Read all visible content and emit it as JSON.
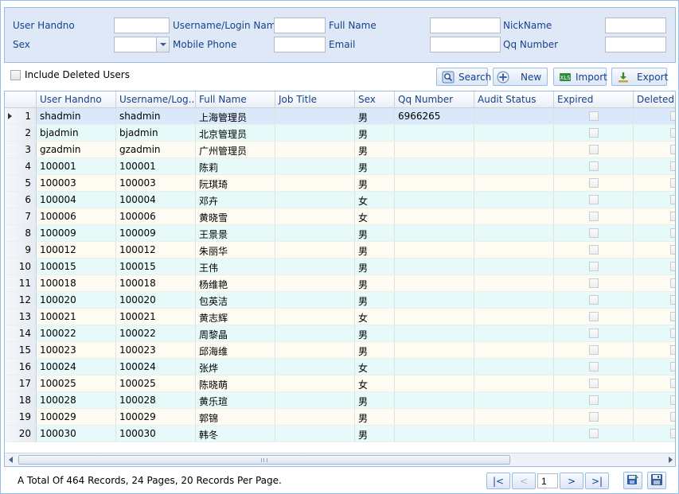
{
  "filters": {
    "user_handno": {
      "label": "User Handno",
      "value": "",
      "placeholder": ""
    },
    "username": {
      "label": "Username/Login Name",
      "value": "",
      "placeholder": ""
    },
    "full_name": {
      "label": "Full Name",
      "value": "",
      "placeholder": ""
    },
    "nickname": {
      "label": "NickName",
      "value": "",
      "placeholder": ""
    },
    "sex": {
      "label": "Sex",
      "value": ""
    },
    "mobile_phone": {
      "label": "Mobile Phone",
      "value": "",
      "placeholder": ""
    },
    "email": {
      "label": "Email",
      "value": "",
      "placeholder": ""
    },
    "qq_number": {
      "label": "Qq Number",
      "value": "",
      "placeholder": ""
    }
  },
  "include_deleted": {
    "label": "Include Deleted Users",
    "checked": false
  },
  "toolbar": {
    "search": "Search",
    "new": "New",
    "import": "Import",
    "export": "Export"
  },
  "grid": {
    "columns": [
      "",
      "User Handno",
      "Username/Log...",
      "Full Name",
      "Job Title",
      "Sex",
      "Qq Number",
      "Audit Status",
      "Expired",
      "Deleted"
    ],
    "rows": [
      {
        "n": "1",
        "handno": "shadmin",
        "username": "shadmin",
        "full_name": "上海管理员",
        "job_title": "",
        "sex": "男",
        "qq": "6966265",
        "audit": ""
      },
      {
        "n": "2",
        "handno": "bjadmin",
        "username": "bjadmin",
        "full_name": "北京管理员",
        "job_title": "",
        "sex": "男",
        "qq": "",
        "audit": ""
      },
      {
        "n": "3",
        "handno": "gzadmin",
        "username": "gzadmin",
        "full_name": "广州管理员",
        "job_title": "",
        "sex": "男",
        "qq": "",
        "audit": ""
      },
      {
        "n": "4",
        "handno": "100001",
        "username": "100001",
        "full_name": "陈莉",
        "job_title": "",
        "sex": "男",
        "qq": "",
        "audit": ""
      },
      {
        "n": "5",
        "handno": "100003",
        "username": "100003",
        "full_name": "阮琪琦",
        "job_title": "",
        "sex": "男",
        "qq": "",
        "audit": ""
      },
      {
        "n": "6",
        "handno": "100004",
        "username": "100004",
        "full_name": "邓卉",
        "job_title": "",
        "sex": "女",
        "qq": "",
        "audit": ""
      },
      {
        "n": "7",
        "handno": "100006",
        "username": "100006",
        "full_name": "黄晓雪",
        "job_title": "",
        "sex": "女",
        "qq": "",
        "audit": ""
      },
      {
        "n": "8",
        "handno": "100009",
        "username": "100009",
        "full_name": "王景景",
        "job_title": "",
        "sex": "男",
        "qq": "",
        "audit": ""
      },
      {
        "n": "9",
        "handno": "100012",
        "username": "100012",
        "full_name": "朱丽华",
        "job_title": "",
        "sex": "男",
        "qq": "",
        "audit": ""
      },
      {
        "n": "10",
        "handno": "100015",
        "username": "100015",
        "full_name": "王伟",
        "job_title": "",
        "sex": "男",
        "qq": "",
        "audit": ""
      },
      {
        "n": "11",
        "handno": "100018",
        "username": "100018",
        "full_name": "杨维艳",
        "job_title": "",
        "sex": "男",
        "qq": "",
        "audit": ""
      },
      {
        "n": "12",
        "handno": "100020",
        "username": "100020",
        "full_name": "包英洁",
        "job_title": "",
        "sex": "男",
        "qq": "",
        "audit": ""
      },
      {
        "n": "13",
        "handno": "100021",
        "username": "100021",
        "full_name": "黄志辉",
        "job_title": "",
        "sex": "女",
        "qq": "",
        "audit": ""
      },
      {
        "n": "14",
        "handno": "100022",
        "username": "100022",
        "full_name": "周黎晶",
        "job_title": "",
        "sex": "男",
        "qq": "",
        "audit": ""
      },
      {
        "n": "15",
        "handno": "100023",
        "username": "100023",
        "full_name": "邱海维",
        "job_title": "",
        "sex": "男",
        "qq": "",
        "audit": ""
      },
      {
        "n": "16",
        "handno": "100024",
        "username": "100024",
        "full_name": "张烨",
        "job_title": "",
        "sex": "女",
        "qq": "",
        "audit": ""
      },
      {
        "n": "17",
        "handno": "100025",
        "username": "100025",
        "full_name": "陈晓萌",
        "job_title": "",
        "sex": "女",
        "qq": "",
        "audit": ""
      },
      {
        "n": "18",
        "handno": "100028",
        "username": "100028",
        "full_name": "黄乐瑄",
        "job_title": "",
        "sex": "男",
        "qq": "",
        "audit": ""
      },
      {
        "n": "19",
        "handno": "100029",
        "username": "100029",
        "full_name": "郭锦",
        "job_title": "",
        "sex": "男",
        "qq": "",
        "audit": ""
      },
      {
        "n": "20",
        "handno": "100030",
        "username": "100030",
        "full_name": "韩冬",
        "job_title": "",
        "sex": "男",
        "qq": "",
        "audit": ""
      }
    ]
  },
  "pager": {
    "summary": "A Total Of 464 Records, 24 Pages, 20 Records Per Page.",
    "first": "|<",
    "prev": "<",
    "page": "1",
    "next": ">",
    "last": ">|"
  },
  "colors": {
    "accent": "#15428b",
    "border": "#99bbe8",
    "panel": "#dfe8f6",
    "row_alt": "#e6fafa",
    "row_even": "#fdfbf2",
    "row_selected": "#d9e8fb"
  }
}
